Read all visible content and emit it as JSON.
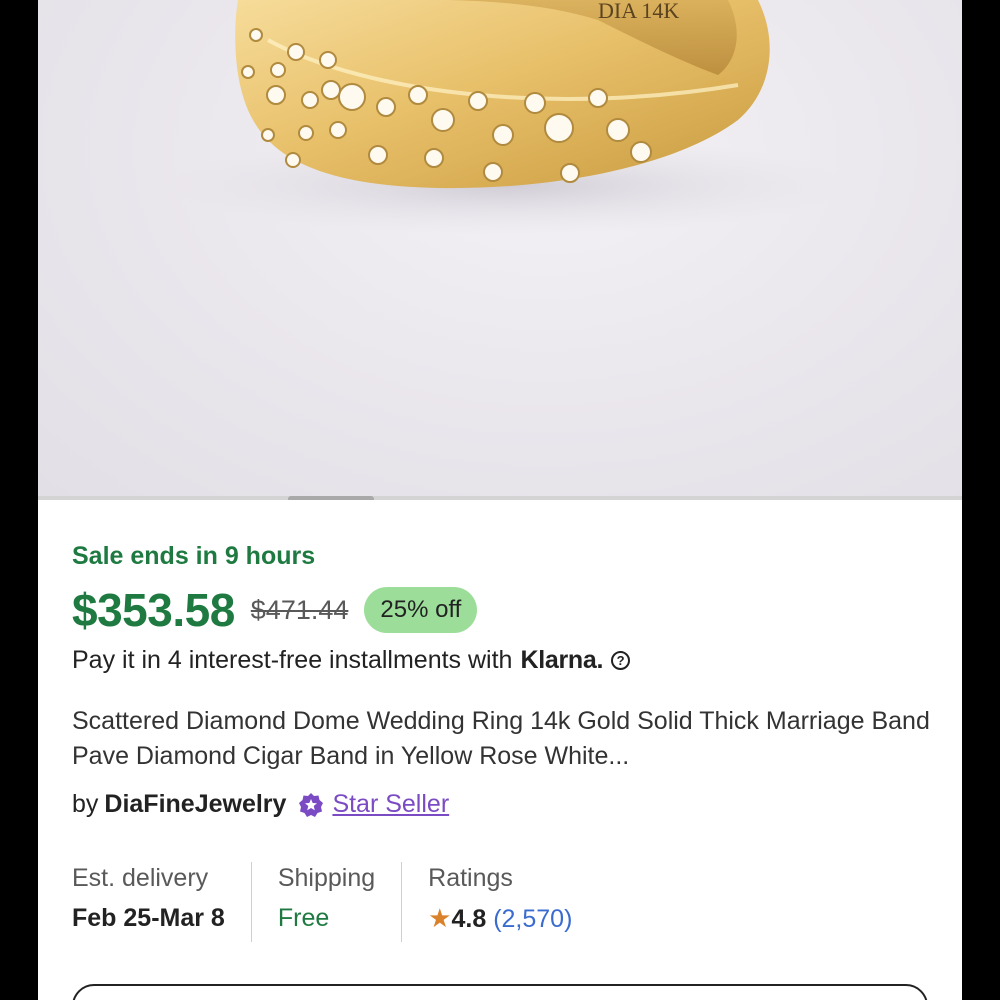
{
  "hero": {
    "image_alt": "Gold ring with scattered diamonds",
    "engraving": "DIA 14K"
  },
  "sale": {
    "text": "Sale ends in 9 hours"
  },
  "price": {
    "current": "$353.58",
    "original": "$471.44",
    "discount": "25% off"
  },
  "klarna": {
    "text": "Pay it in 4 interest-free installments with",
    "logo": "Klarna.",
    "help_icon": "?"
  },
  "product": {
    "title": "Scattered Diamond Dome Wedding Ring 14k Gold Solid Thick Marriage Band Pave Diamond Cigar Band in Yellow Rose White..."
  },
  "seller": {
    "by": "by",
    "name": "DiaFineJewelry",
    "badge": "Star Seller"
  },
  "delivery": {
    "label": "Est. delivery",
    "value": "Feb 25-Mar 8"
  },
  "shipping": {
    "label": "Shipping",
    "value": "Free"
  },
  "ratings": {
    "label": "Ratings",
    "star": "★",
    "value": "4.8",
    "count": "(2,570)"
  },
  "colors": {
    "sale_green": "#1e7a41",
    "badge_green": "#9cde99",
    "star_seller_purple": "#7b4bc4",
    "link_blue": "#3a6ccf",
    "star_orange": "#d9822b"
  }
}
